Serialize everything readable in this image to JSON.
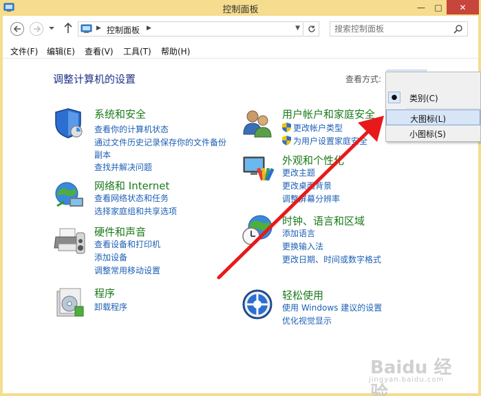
{
  "window": {
    "title": "控制面板",
    "controls": {
      "minimize": "—",
      "maximize": "□",
      "close": "✕"
    }
  },
  "address": {
    "breadcrumb": "控制面板",
    "search_placeholder": "搜索控制面板"
  },
  "menubar": {
    "items": [
      "文件(F)",
      "编辑(E)",
      "查看(V)",
      "工具(T)",
      "帮助(H)"
    ]
  },
  "header": {
    "title": "调整计算机的设置",
    "view_by_label": "查看方式:",
    "view_by_value": "类别"
  },
  "categories": {
    "system_security": {
      "title": "系统和安全",
      "links": [
        "查看你的计算机状态",
        "通过文件历史记录保存你的文件备份",
        "副本",
        "查找并解决问题"
      ]
    },
    "network": {
      "title": "网络和 Internet",
      "links": [
        "查看网络状态和任务",
        "选择家庭组和共享选项"
      ]
    },
    "hardware": {
      "title": "硬件和声音",
      "links": [
        "查看设备和打印机",
        "添加设备",
        "调整常用移动设置"
      ]
    },
    "programs": {
      "title": "程序",
      "links": [
        "卸载程序"
      ]
    },
    "user_accounts": {
      "title": "用户帐户和家庭安全",
      "links": [
        "更改帐户类型",
        "为用户设置家庭安全"
      ]
    },
    "appearance": {
      "title": "外观和个性化",
      "links": [
        "更改主题",
        "更改桌面背景",
        "调整屏幕分辨率"
      ]
    },
    "clock_region": {
      "title": "时钟、语言和区域",
      "links": [
        "添加语言",
        "更换输入法",
        "更改日期、时间或数字格式"
      ]
    },
    "ease_access": {
      "title": "轻松使用",
      "links": [
        "使用 Windows 建议的设置",
        "优化视觉显示"
      ]
    }
  },
  "view_menu": {
    "options": [
      "类别(C)",
      "大图标(L)",
      "小图标(S)"
    ],
    "selected_index": 0,
    "hovered_index": 1
  },
  "watermark": {
    "text": "Baidu 经验",
    "sub": "jingyan.baidu.com"
  },
  "colors": {
    "title_bar": "#f6dc8e",
    "category_title": "#1a7a1a",
    "link": "#1c5fb5",
    "annotation_arrow": "#e8191b"
  }
}
